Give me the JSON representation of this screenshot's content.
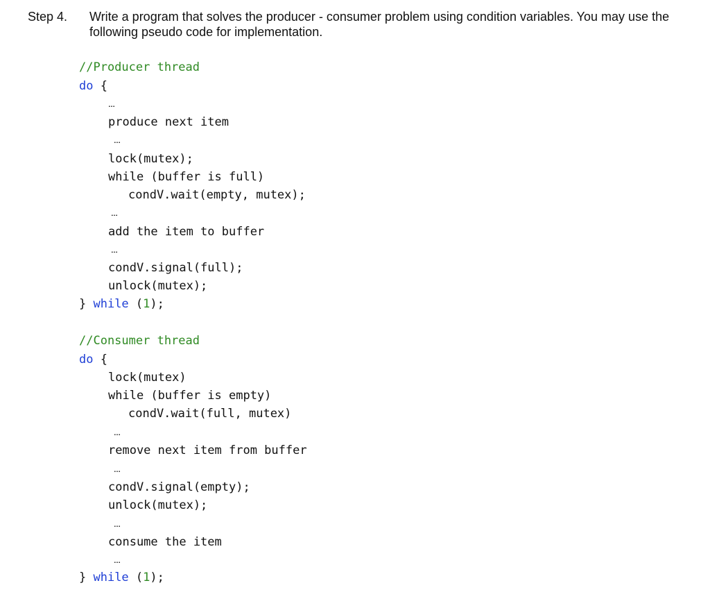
{
  "step": {
    "label": "Step 4.",
    "text": "Write a program that solves the producer - consumer problem using condition variables. You may use the following pseudo code for implementation."
  },
  "colors": {
    "comment": "#2f8a23",
    "keyword": "#1f3fd6",
    "number": "#2f8a23",
    "text": "#111111"
  },
  "code": {
    "ellipsis": "…",
    "producer": {
      "comment": "//Producer thread",
      "do_kw": "do",
      "open_brace": " {",
      "produce": "produce next item",
      "lock": "lock(mutex);",
      "while_check": "while (buffer is full)",
      "wait": "condV.wait(empty, mutex);",
      "add": "add the item to buffer",
      "signal": "condV.signal(full);",
      "unlock": "unlock(mutex);",
      "close_brace": "} ",
      "while_kw": "while",
      "cond_open": " (",
      "cond_num": "1",
      "cond_close": ");"
    },
    "consumer": {
      "comment": "//Consumer thread",
      "do_kw": "do",
      "open_brace": " {",
      "lock": "lock(mutex)",
      "while_check": "while (buffer is empty)",
      "wait": "condV.wait(full, mutex)",
      "remove": "remove next item from buffer",
      "signal": "condV.signal(empty);",
      "unlock": "unlock(mutex);",
      "consume": "consume the item",
      "close_brace": "} ",
      "while_kw": "while",
      "cond_open": " (",
      "cond_num": "1",
      "cond_close": ");"
    }
  }
}
